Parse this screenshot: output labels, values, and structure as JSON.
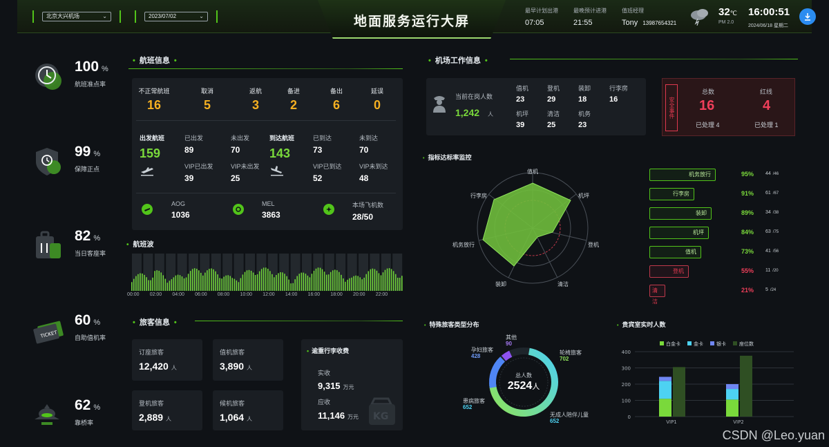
{
  "header": {
    "airport": "北京大兴机场",
    "date": "2023/07/02",
    "title": "地面服务运行大屏",
    "earliest_label": "最早计划出港",
    "earliest_value": "07:05",
    "latest_label": "最晚预计进港",
    "latest_value": "21:55",
    "manager_label": "值班经理",
    "manager_name": "Tony",
    "manager_phone": "13987654321",
    "temp": "32",
    "temp_unit": "℃",
    "pm": "PM 2.0",
    "time": "16:00:51",
    "today": "2024/06/18",
    "weekday": "星期二"
  },
  "kpis": [
    {
      "value": "100",
      "unit": "%",
      "label": "航班准点率"
    },
    {
      "value": "99",
      "unit": "%",
      "label": "保障正点"
    },
    {
      "value": "82",
      "unit": "%",
      "label": "当日客座率"
    },
    {
      "value": "60",
      "unit": "%",
      "label": "自助值机率"
    },
    {
      "value": "62",
      "unit": "%",
      "label": "靠桥率"
    }
  ],
  "flight": {
    "title": "航班信息",
    "abnormal": [
      {
        "label": "不正常航班",
        "value": "16"
      },
      {
        "label": "取消",
        "value": "5"
      },
      {
        "label": "返航",
        "value": "3"
      },
      {
        "label": "备进",
        "value": "2"
      },
      {
        "label": "备出",
        "value": "6"
      },
      {
        "label": "延误",
        "value": "0"
      }
    ],
    "dep_label": "出发航班",
    "dep_value": "159",
    "dep_done_label": "已出发",
    "dep_done": "89",
    "dep_not_label": "未出发",
    "dep_not": "70",
    "dep_vip_done_label": "VIP已出发",
    "dep_vip_done": "39",
    "dep_vip_not_label": "VIP未出发",
    "dep_vip_not": "25",
    "arr_label": "到达航班",
    "arr_value": "143",
    "arr_done_label": "已到达",
    "arr_done": "73",
    "arr_not_label": "未到达",
    "arr_not": "70",
    "arr_vip_done_label": "VIP已到达",
    "arr_vip_done": "52",
    "arr_vip_not_label": "VIP未到达",
    "arr_vip_not": "48",
    "aog_label": "AOG",
    "aog": "1036",
    "mel_label": "MEL",
    "mel": "3863",
    "local_label": "本场飞机数",
    "local": "28/50"
  },
  "wave": {
    "title": "航班波",
    "ticks": [
      "00:00",
      "02:00",
      "04:00",
      "06:00",
      "08:00",
      "10:00",
      "12:00",
      "14:00",
      "16:00",
      "18:00",
      "20:00",
      "22:00"
    ]
  },
  "passenger": {
    "title": "旅客信息",
    "booked_label": "订座旅客",
    "booked": "12,420",
    "checkin_label": "值机旅客",
    "checkin": "3,890",
    "boarded_label": "登机旅客",
    "boarded": "2,889",
    "waiting_label": "候机旅客",
    "waiting": "1,064",
    "unit": "人",
    "baggage_title": "逾重行李收费",
    "paid_label": "实收",
    "paid": "9,315",
    "due_label": "应收",
    "due": "11,146",
    "money_unit": "万元"
  },
  "work": {
    "title": "机场工作信息",
    "onduty_label": "当前在岗人数",
    "onduty": "1,242",
    "unit": "人",
    "roles": [
      {
        "label": "值机",
        "value": "23"
      },
      {
        "label": "登机",
        "value": "29"
      },
      {
        "label": "装卸",
        "value": "18"
      },
      {
        "label": "行李房",
        "value": "16"
      },
      {
        "label": "机坪",
        "value": "39"
      },
      {
        "label": "清洁",
        "value": "25"
      },
      {
        "label": "机务",
        "value": "23"
      }
    ],
    "safety_label": "安全事件",
    "total_label": "总数",
    "total": "16",
    "total_done": "已处理 4",
    "red_label": "红线",
    "red": "4",
    "red_done": "已处理 1"
  },
  "radar": {
    "title": "指标达标率监控",
    "axes": [
      "值机",
      "机坪",
      "登机",
      "清洁",
      "装卸",
      "机务放行",
      "行李房"
    ]
  },
  "bars": [
    {
      "label": "机务放行",
      "pct": "95%",
      "count": "44",
      "total": "/46",
      "status": "ok"
    },
    {
      "label": "行李房",
      "pct": "91%",
      "count": "61",
      "total": "/67",
      "status": "ok"
    },
    {
      "label": "装卸",
      "pct": "89%",
      "count": "34",
      "total": "/38",
      "status": "ok"
    },
    {
      "label": "机坪",
      "pct": "84%",
      "count": "63",
      "total": "/75",
      "status": "ok"
    },
    {
      "label": "值机",
      "pct": "73%",
      "count": "41",
      "total": "/56",
      "status": "ok"
    },
    {
      "label": "登机",
      "pct": "55%",
      "count": "11",
      "total": "/20",
      "status": "bad"
    },
    {
      "label": "清洁",
      "pct": "21%",
      "count": "5",
      "total": "/24",
      "status": "bad"
    }
  ],
  "special": {
    "title": "特殊旅客类型分布",
    "center_label": "总人数",
    "center_value": "2524",
    "center_unit": "人",
    "slices": [
      {
        "label": "其他",
        "value": "90"
      },
      {
        "label": "轮椅旅客",
        "value": "702"
      },
      {
        "label": "无成人陪伴儿童",
        "value": "652"
      },
      {
        "label": "患病旅客",
        "value": "652"
      },
      {
        "label": "孕妇旅客",
        "value": "428"
      }
    ]
  },
  "chart_data": {
    "type": "bar",
    "title": "贵宾室实时人数",
    "categories": [
      "VIP1",
      "VIP2"
    ],
    "series": [
      {
        "name": "白金卡",
        "values": [
          110,
          105
        ]
      },
      {
        "name": "金卡",
        "values": [
          110,
          65
        ]
      },
      {
        "name": "银卡",
        "values": [
          25,
          30
        ]
      },
      {
        "name": "座位数",
        "values": [
          305,
          375
        ]
      }
    ],
    "ylim": [
      0,
      400
    ],
    "yticks": [
      "400",
      "300",
      "200",
      "100",
      "0"
    ],
    "legend": "top",
    "colors": {
      "platinum": "#7ad93b",
      "gold": "#4dd2f2",
      "silver": "#6f86f2",
      "seats": "#2f4f23"
    }
  },
  "watermark": "CSDN @Leo.yuan"
}
